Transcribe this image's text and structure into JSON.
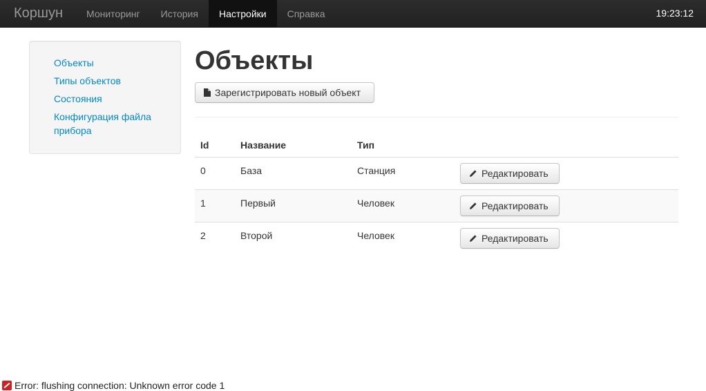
{
  "navbar": {
    "brand": "Коршун",
    "items": [
      {
        "label": "Мониторинг",
        "active": false
      },
      {
        "label": "История",
        "active": false
      },
      {
        "label": "Настройки",
        "active": true
      },
      {
        "label": "Справка",
        "active": false
      }
    ],
    "clock": "19:23:12"
  },
  "sidebar": {
    "items": [
      {
        "label": "Объекты"
      },
      {
        "label": "Типы объектов"
      },
      {
        "label": "Состояния"
      },
      {
        "label": "Конфигурация файла прибора"
      }
    ]
  },
  "main": {
    "title": "Объекты",
    "register_button": "Зарегистрировать новый объект",
    "table": {
      "headers": [
        "Id",
        "Название",
        "Тип",
        ""
      ],
      "rows": [
        {
          "id": "0",
          "name": "База",
          "type": "Станция",
          "action": "Редактировать"
        },
        {
          "id": "1",
          "name": "Первый",
          "type": "Человек",
          "action": "Редактировать"
        },
        {
          "id": "2",
          "name": "Второй",
          "type": "Человек",
          "action": "Редактировать"
        }
      ]
    }
  },
  "status": {
    "error": "Error: flushing connection: Unknown error code 1"
  },
  "colors": {
    "navbar_bg": "#222222",
    "link": "#0088cc",
    "active_nav_bg": "#111111",
    "error_icon": "#cc2222"
  }
}
